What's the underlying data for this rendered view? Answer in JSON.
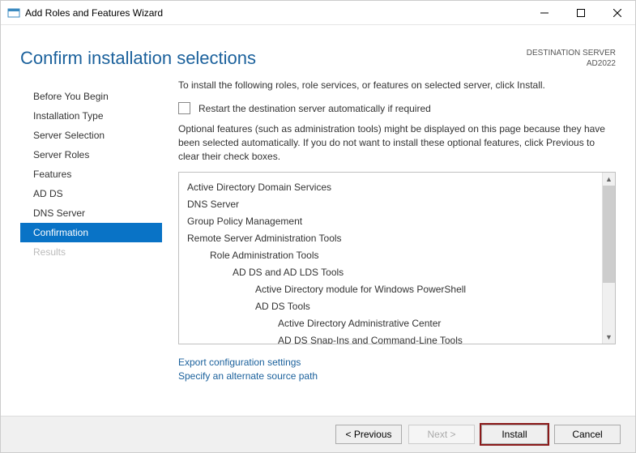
{
  "titlebar": {
    "title": "Add Roles and Features Wizard"
  },
  "header": {
    "page_title": "Confirm installation selections",
    "dest_label": "DESTINATION SERVER",
    "dest_server": "AD2022"
  },
  "sidebar": {
    "items": [
      {
        "label": "Before You Begin",
        "state": "normal"
      },
      {
        "label": "Installation Type",
        "state": "normal"
      },
      {
        "label": "Server Selection",
        "state": "normal"
      },
      {
        "label": "Server Roles",
        "state": "normal"
      },
      {
        "label": "Features",
        "state": "normal"
      },
      {
        "label": "AD DS",
        "state": "normal"
      },
      {
        "label": "DNS Server",
        "state": "normal"
      },
      {
        "label": "Confirmation",
        "state": "active"
      },
      {
        "label": "Results",
        "state": "disabled"
      }
    ]
  },
  "main": {
    "intro": "To install the following roles, role services, or features on selected server, click Install.",
    "restart_checkbox_label": "Restart the destination server automatically if required",
    "restart_checked": false,
    "optional_note": "Optional features (such as administration tools) might be displayed on this page because they have been selected automatically. If you do not want to install these optional features, click Previous to clear their check boxes.",
    "tree": [
      {
        "label": "Active Directory Domain Services",
        "indent": 1
      },
      {
        "label": "DNS Server",
        "indent": 1
      },
      {
        "label": "Group Policy Management",
        "indent": 1
      },
      {
        "label": "Remote Server Administration Tools",
        "indent": 1
      },
      {
        "label": "Role Administration Tools",
        "indent": 2
      },
      {
        "label": "AD DS and AD LDS Tools",
        "indent": 3
      },
      {
        "label": "Active Directory module for Windows PowerShell",
        "indent": 4
      },
      {
        "label": "AD DS Tools",
        "indent": 4
      },
      {
        "label": "Active Directory Administrative Center",
        "indent": 5
      },
      {
        "label": "AD DS Snap-Ins and Command-Line Tools",
        "indent": 5
      }
    ],
    "links": {
      "export": "Export configuration settings",
      "specify": "Specify an alternate source path"
    }
  },
  "footer": {
    "previous": "< Previous",
    "next": "Next >",
    "install": "Install",
    "cancel": "Cancel"
  }
}
